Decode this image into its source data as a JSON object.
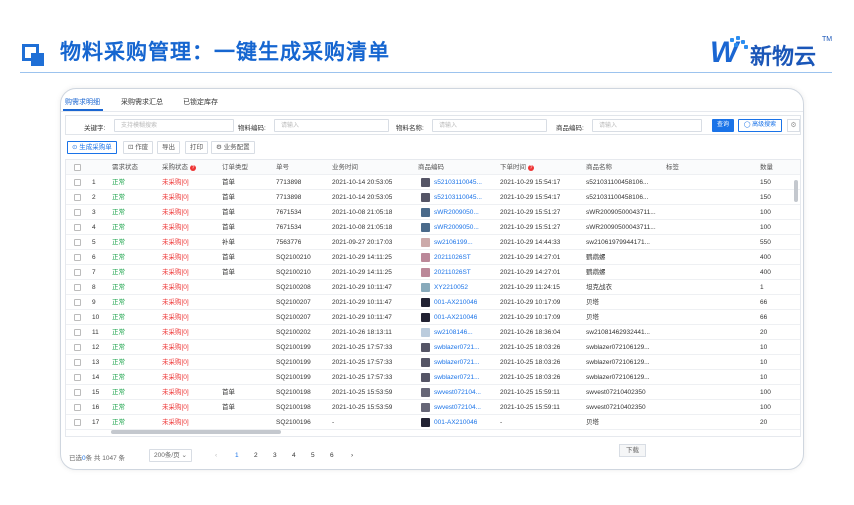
{
  "banner": {
    "title": "物料采购管理：一键生成采购清单",
    "logo_text": "新物云",
    "logo_tm": "TM"
  },
  "tabs": [
    {
      "label": "购需求明细",
      "active": true
    },
    {
      "label": "采购需求汇总",
      "active": false
    },
    {
      "label": "已锁定库存",
      "active": false
    }
  ],
  "search": {
    "keyword_label": "关键字:",
    "keyword_placeholder": "支持模糊搜索",
    "material_code_label": "物料编码:",
    "material_code_placeholder": "请输入",
    "material_name_label": "物料名称:",
    "material_name_placeholder": "请输入",
    "product_code_label": "商品编码:",
    "product_code_placeholder": "请输入",
    "query_label": "查询",
    "advanced_label": "◯ 高级搜索",
    "settings_icon": "gear-icon"
  },
  "toolbar": {
    "generate_label": "⊙ 生成采购单",
    "void_label": "⊡ 作废",
    "export_label": "导出",
    "print_label": "打印",
    "config_label": "⚙ 业务配置"
  },
  "table": {
    "headers": [
      "需求状态",
      "采购状态",
      "订单类型",
      "单号",
      "业务时间",
      "商品编码",
      "下单时间",
      "商品名称",
      "标签",
      "数量"
    ],
    "rows": [
      {
        "n": "1",
        "status": "正常",
        "purchase": "未采购[0]",
        "type": "首单",
        "order": "7713898",
        "biz_time": "2021-10-14 20:53:05",
        "code": "s52103110045...",
        "order_time": "2021-10-29 15:54:17",
        "name": "s521031100458106...",
        "tag": "",
        "qty": "150",
        "thumb": "#556"
      },
      {
        "n": "2",
        "status": "正常",
        "purchase": "未采购[0]",
        "type": "首单",
        "order": "7713898",
        "biz_time": "2021-10-14 20:53:05",
        "code": "s52103110045...",
        "order_time": "2021-10-29 15:54:17",
        "name": "s521031100458106...",
        "tag": "",
        "qty": "150",
        "thumb": "#556"
      },
      {
        "n": "3",
        "status": "正常",
        "purchase": "未采购[0]",
        "type": "首单",
        "order": "7671534",
        "biz_time": "2021-10-08 21:05:18",
        "code": "sWR2009050...",
        "order_time": "2021-10-29 15:51:27",
        "name": "sWR20090500043711...",
        "tag": "",
        "qty": "100",
        "thumb": "#4a6a8a"
      },
      {
        "n": "4",
        "status": "正常",
        "purchase": "未采购[0]",
        "type": "首单",
        "order": "7671534",
        "biz_time": "2021-10-08 21:05:18",
        "code": "sWR2009050...",
        "order_time": "2021-10-29 15:51:27",
        "name": "sWR20090500043711...",
        "tag": "",
        "qty": "100",
        "thumb": "#4a6a8a"
      },
      {
        "n": "5",
        "status": "正常",
        "purchase": "未采购[0]",
        "type": "补单",
        "order": "7563776",
        "biz_time": "2021-09-27 20:17:03",
        "code": "sw2106199...",
        "order_time": "2021-10-29 14:44:33",
        "name": "sw21061979944171...",
        "tag": "",
        "qty": "550",
        "thumb": "#caa"
      },
      {
        "n": "6",
        "status": "正常",
        "purchase": "未采购[0]",
        "type": "首单",
        "order": "SQ2100210",
        "biz_time": "2021-10-29 14:11:25",
        "code": "20211026ST",
        "order_time": "2021-10-29 14:27:01",
        "name": "鹦鹉螺",
        "tag": "",
        "qty": "400",
        "thumb": "#b89"
      },
      {
        "n": "7",
        "status": "正常",
        "purchase": "未采购[0]",
        "type": "首单",
        "order": "SQ2100210",
        "biz_time": "2021-10-29 14:11:25",
        "code": "20211026ST",
        "order_time": "2021-10-29 14:27:01",
        "name": "鹦鹉螺",
        "tag": "",
        "qty": "400",
        "thumb": "#b89"
      },
      {
        "n": "8",
        "status": "正常",
        "purchase": "未采购[0]",
        "type": "",
        "order": "SQ2100208",
        "biz_time": "2021-10-29 10:11:47",
        "code": "XY2210052",
        "order_time": "2021-10-29 11:24:15",
        "name": "坦克战衣",
        "tag": "",
        "qty": "1",
        "thumb": "#8ab"
      },
      {
        "n": "9",
        "status": "正常",
        "purchase": "未采购[0]",
        "type": "",
        "order": "SQ2100207",
        "biz_time": "2021-10-29 10:11:47",
        "code": "001-AX210046",
        "order_time": "2021-10-29 10:17:09",
        "name": "贝塔",
        "tag": "",
        "qty": "66",
        "thumb": "#223"
      },
      {
        "n": "10",
        "status": "正常",
        "purchase": "未采购[0]",
        "type": "",
        "order": "SQ2100207",
        "biz_time": "2021-10-29 10:11:47",
        "code": "001-AX210046",
        "order_time": "2021-10-29 10:17:09",
        "name": "贝塔",
        "tag": "",
        "qty": "66",
        "thumb": "#223"
      },
      {
        "n": "11",
        "status": "正常",
        "purchase": "未采购[0]",
        "type": "",
        "order": "SQ2100202",
        "biz_time": "2021-10-26 18:13:11",
        "code": "sw2108146...",
        "order_time": "2021-10-26 18:36:04",
        "name": "sw21081462932441...",
        "tag": "",
        "qty": "20",
        "thumb": "#bcd"
      },
      {
        "n": "12",
        "status": "正常",
        "purchase": "未采购[0]",
        "type": "",
        "order": "SQ2100199",
        "biz_time": "2021-10-25 17:57:33",
        "code": "swblazer0721...",
        "order_time": "2021-10-25 18:03:26",
        "name": "swblazer072106129...",
        "tag": "",
        "qty": "10",
        "thumb": "#556"
      },
      {
        "n": "13",
        "status": "正常",
        "purchase": "未采购[0]",
        "type": "",
        "order": "SQ2100199",
        "biz_time": "2021-10-25 17:57:33",
        "code": "swblazer0721...",
        "order_time": "2021-10-25 18:03:26",
        "name": "swblazer072106129...",
        "tag": "",
        "qty": "10",
        "thumb": "#556"
      },
      {
        "n": "14",
        "status": "正常",
        "purchase": "未采购[0]",
        "type": "",
        "order": "SQ2100199",
        "biz_time": "2021-10-25 17:57:33",
        "code": "swblazer0721...",
        "order_time": "2021-10-25 18:03:26",
        "name": "swblazer072106129...",
        "tag": "",
        "qty": "10",
        "thumb": "#556"
      },
      {
        "n": "15",
        "status": "正常",
        "purchase": "未采购[0]",
        "type": "首单",
        "order": "SQ2100198",
        "biz_time": "2021-10-25 15:53:59",
        "code": "swvest072104...",
        "order_time": "2021-10-25 15:59:11",
        "name": "swvest07210402350",
        "tag": "",
        "qty": "100",
        "thumb": "#667"
      },
      {
        "n": "16",
        "status": "正常",
        "purchase": "未采购[0]",
        "type": "首单",
        "order": "SQ2100198",
        "biz_time": "2021-10-25 15:53:59",
        "code": "swvest072104...",
        "order_time": "2021-10-25 15:59:11",
        "name": "swvest07210402350",
        "tag": "",
        "qty": "100",
        "thumb": "#667"
      },
      {
        "n": "17",
        "status": "正常",
        "purchase": "未采购[0]",
        "type": "",
        "order": "SQ2100196",
        "biz_time": "-",
        "code": "001-AX210046",
        "order_time": "-",
        "name": "贝塔",
        "tag": "",
        "qty": "20",
        "thumb": "#223"
      }
    ]
  },
  "footer": {
    "selected_prefix": "已选",
    "selected_count": "0",
    "selected_suffix": "条  共 1047 条",
    "page_size": "200条/页",
    "prev": "‹",
    "pages": [
      "1",
      "2",
      "3",
      "4",
      "5",
      "6"
    ],
    "next": "›",
    "download_label": "下载"
  },
  "colors": {
    "accent": "#1a73e8",
    "status_ok": "#1aa34a",
    "status_pending": "#e33"
  }
}
